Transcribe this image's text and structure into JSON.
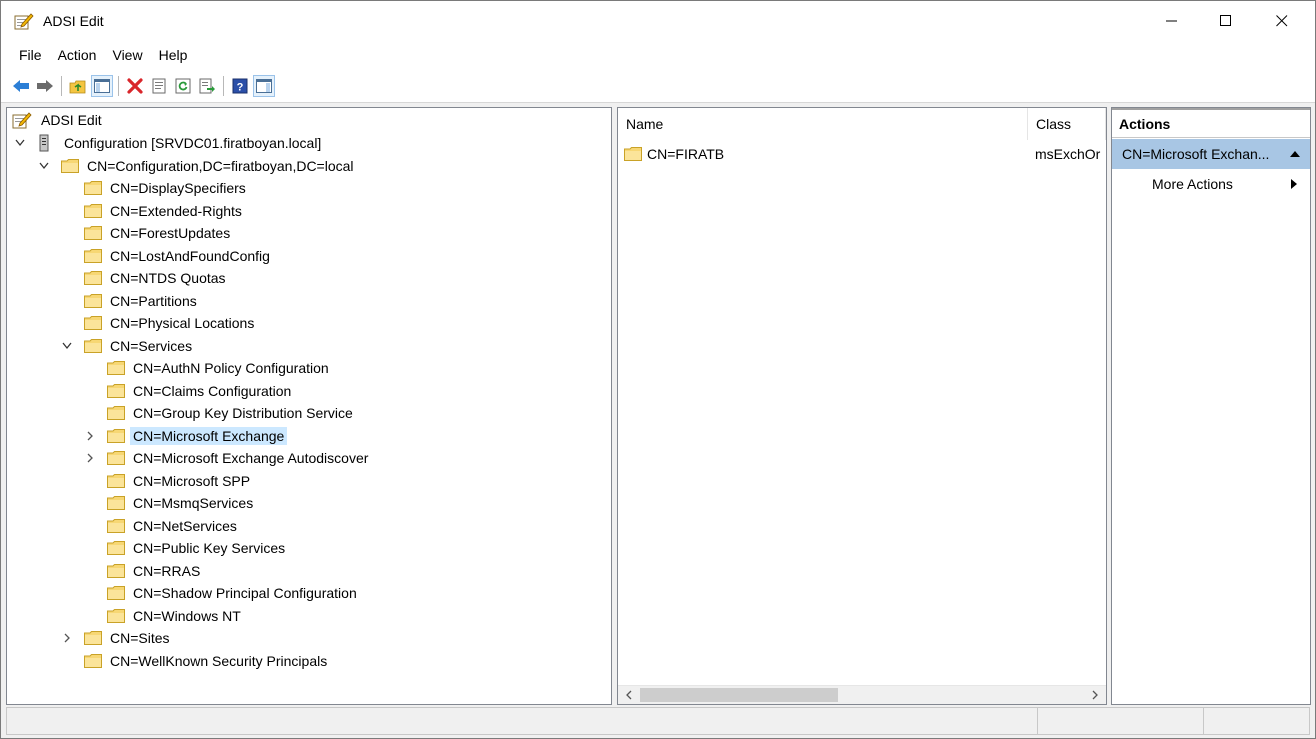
{
  "window": {
    "title": "ADSI Edit",
    "icons": {
      "app": "adsi-edit-icon",
      "minimize": "minimize-icon",
      "maximize": "maximize-icon",
      "close": "close-icon"
    }
  },
  "menu": [
    "File",
    "Action",
    "View",
    "Help"
  ],
  "toolbar": {
    "buttons": [
      "back-arrow-icon",
      "forward-arrow-icon",
      "up-folder-icon",
      "show-hide-tree-icon",
      "delete-icon",
      "properties-icon",
      "refresh-icon",
      "export-list-icon",
      "help-icon",
      "show-hide-action-pane-icon"
    ],
    "colors": {
      "back": "#2c7fd6",
      "delete": "#d9262b"
    }
  },
  "tree": {
    "root": "ADSI Edit",
    "nodes": [
      {
        "label": "Configuration [SRVDC01.firatboyan.local]",
        "level": 1,
        "expander": "open",
        "icon": "server-icon"
      },
      {
        "label": "CN=Configuration,DC=firatboyan,DC=local",
        "level": 2,
        "expander": "open",
        "icon": "folder-icon"
      },
      {
        "label": "CN=DisplaySpecifiers",
        "level": 3,
        "expander": "",
        "icon": "folder-icon"
      },
      {
        "label": "CN=Extended-Rights",
        "level": 3,
        "expander": "",
        "icon": "folder-icon"
      },
      {
        "label": "CN=ForestUpdates",
        "level": 3,
        "expander": "",
        "icon": "folder-icon"
      },
      {
        "label": "CN=LostAndFoundConfig",
        "level": 3,
        "expander": "",
        "icon": "folder-icon"
      },
      {
        "label": "CN=NTDS Quotas",
        "level": 3,
        "expander": "",
        "icon": "folder-icon"
      },
      {
        "label": "CN=Partitions",
        "level": 3,
        "expander": "",
        "icon": "folder-icon"
      },
      {
        "label": "CN=Physical Locations",
        "level": 3,
        "expander": "",
        "icon": "folder-icon"
      },
      {
        "label": "CN=Services",
        "level": 3,
        "expander": "open",
        "icon": "folder-icon"
      },
      {
        "label": "CN=AuthN Policy Configuration",
        "level": 4,
        "expander": "",
        "icon": "folder-icon"
      },
      {
        "label": "CN=Claims Configuration",
        "level": 4,
        "expander": "",
        "icon": "folder-icon"
      },
      {
        "label": "CN=Group Key Distribution Service",
        "level": 4,
        "expander": "",
        "icon": "folder-icon"
      },
      {
        "label": "CN=Microsoft Exchange",
        "level": 4,
        "expander": "closed",
        "icon": "folder-icon",
        "selected": true
      },
      {
        "label": "CN=Microsoft Exchange Autodiscover",
        "level": 4,
        "expander": "closed",
        "icon": "folder-icon"
      },
      {
        "label": "CN=Microsoft SPP",
        "level": 4,
        "expander": "",
        "icon": "folder-icon"
      },
      {
        "label": "CN=MsmqServices",
        "level": 4,
        "expander": "",
        "icon": "folder-icon"
      },
      {
        "label": "CN=NetServices",
        "level": 4,
        "expander": "",
        "icon": "folder-icon"
      },
      {
        "label": "CN=Public Key Services",
        "level": 4,
        "expander": "",
        "icon": "folder-icon"
      },
      {
        "label": "CN=RRAS",
        "level": 4,
        "expander": "",
        "icon": "folder-icon"
      },
      {
        "label": "CN=Shadow Principal Configuration",
        "level": 4,
        "expander": "",
        "icon": "folder-icon"
      },
      {
        "label": "CN=Windows NT",
        "level": 4,
        "expander": "",
        "icon": "folder-icon"
      },
      {
        "label": "CN=Sites",
        "level": 3,
        "expander": "closed",
        "icon": "folder-icon"
      },
      {
        "label": "CN=WellKnown Security Principals",
        "level": 3,
        "expander": "",
        "icon": "folder-icon"
      }
    ],
    "selection_color": "#cce8ff"
  },
  "list": {
    "columns": [
      "Name",
      "Class"
    ],
    "rows": [
      {
        "name": "CN=FIRATB",
        "class": "msExchOr"
      }
    ]
  },
  "actions": {
    "header": "Actions",
    "section": "CN=Microsoft Exchan...",
    "items": [
      "More Actions"
    ],
    "section_color": "#a8c6e4"
  }
}
